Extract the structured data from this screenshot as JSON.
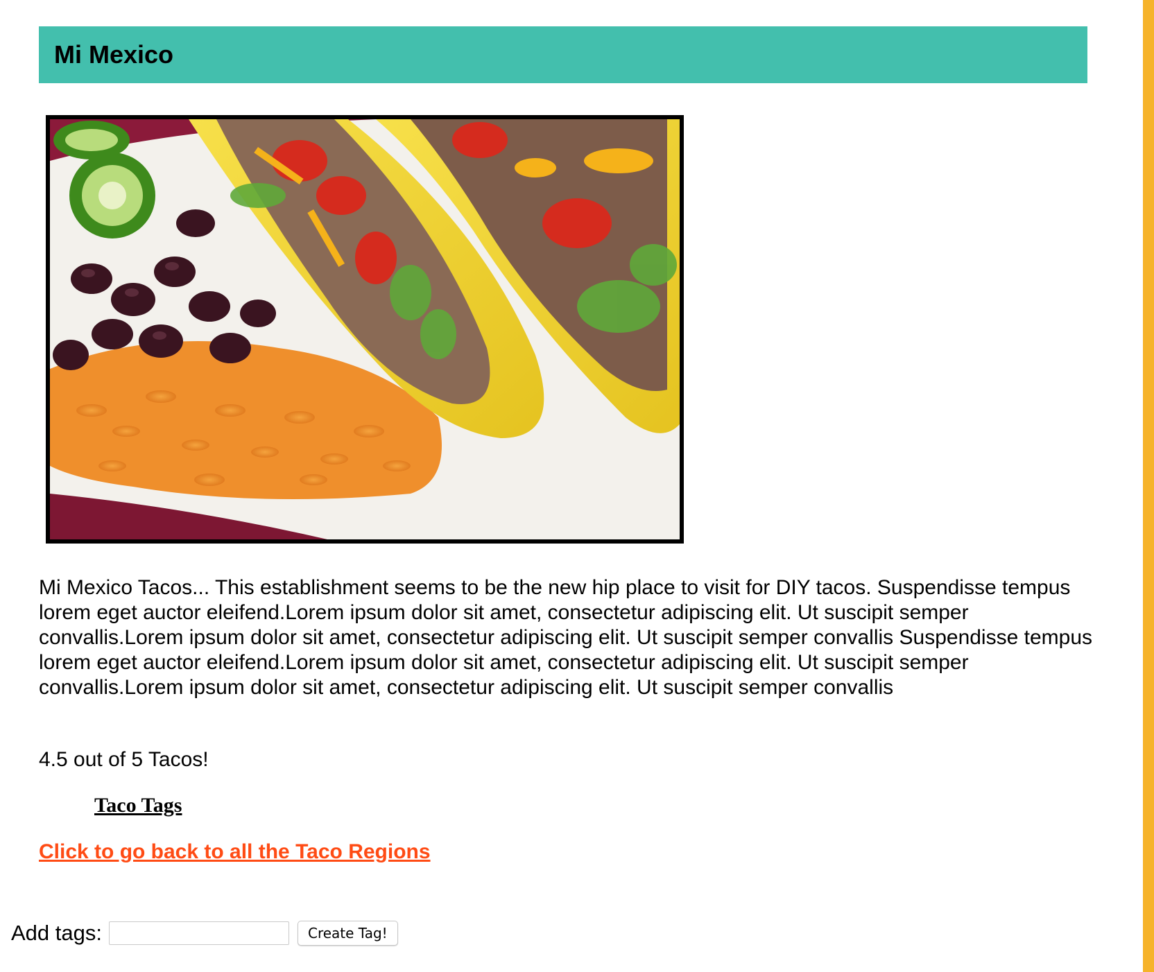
{
  "header": {
    "title": "Mi Mexico"
  },
  "photo": {
    "alt": "Plate of tacos with black beans, rice and jalapeño slices"
  },
  "main": {
    "description": "Mi Mexico Tacos... This establishment seems to be the new hip place to visit for DIY tacos. Suspendisse tempus lorem eget auctor eleifend.Lorem ipsum dolor sit amet, consectetur adipiscing elit. Ut suscipit semper convallis.Lorem ipsum dolor sit amet, consectetur adipiscing elit. Ut suscipit semper convallis Suspendisse tempus lorem eget auctor eleifend.Lorem ipsum dolor sit amet, consectetur adipiscing elit. Ut suscipit semper convallis.Lorem ipsum dolor sit amet, consectetur adipiscing elit. Ut suscipit semper convallis",
    "rating": "4.5 out of 5 Tacos!",
    "tags_heading": "Taco Tags",
    "back_link": "Click to go back to all the Taco Regions"
  },
  "tag_form": {
    "label": "Add tags:",
    "input_value": "",
    "button_label": "Create Tag!"
  },
  "colors": {
    "header_bg": "#43bfad",
    "link": "#ff4b14",
    "right_bar": "#f6b32a"
  }
}
